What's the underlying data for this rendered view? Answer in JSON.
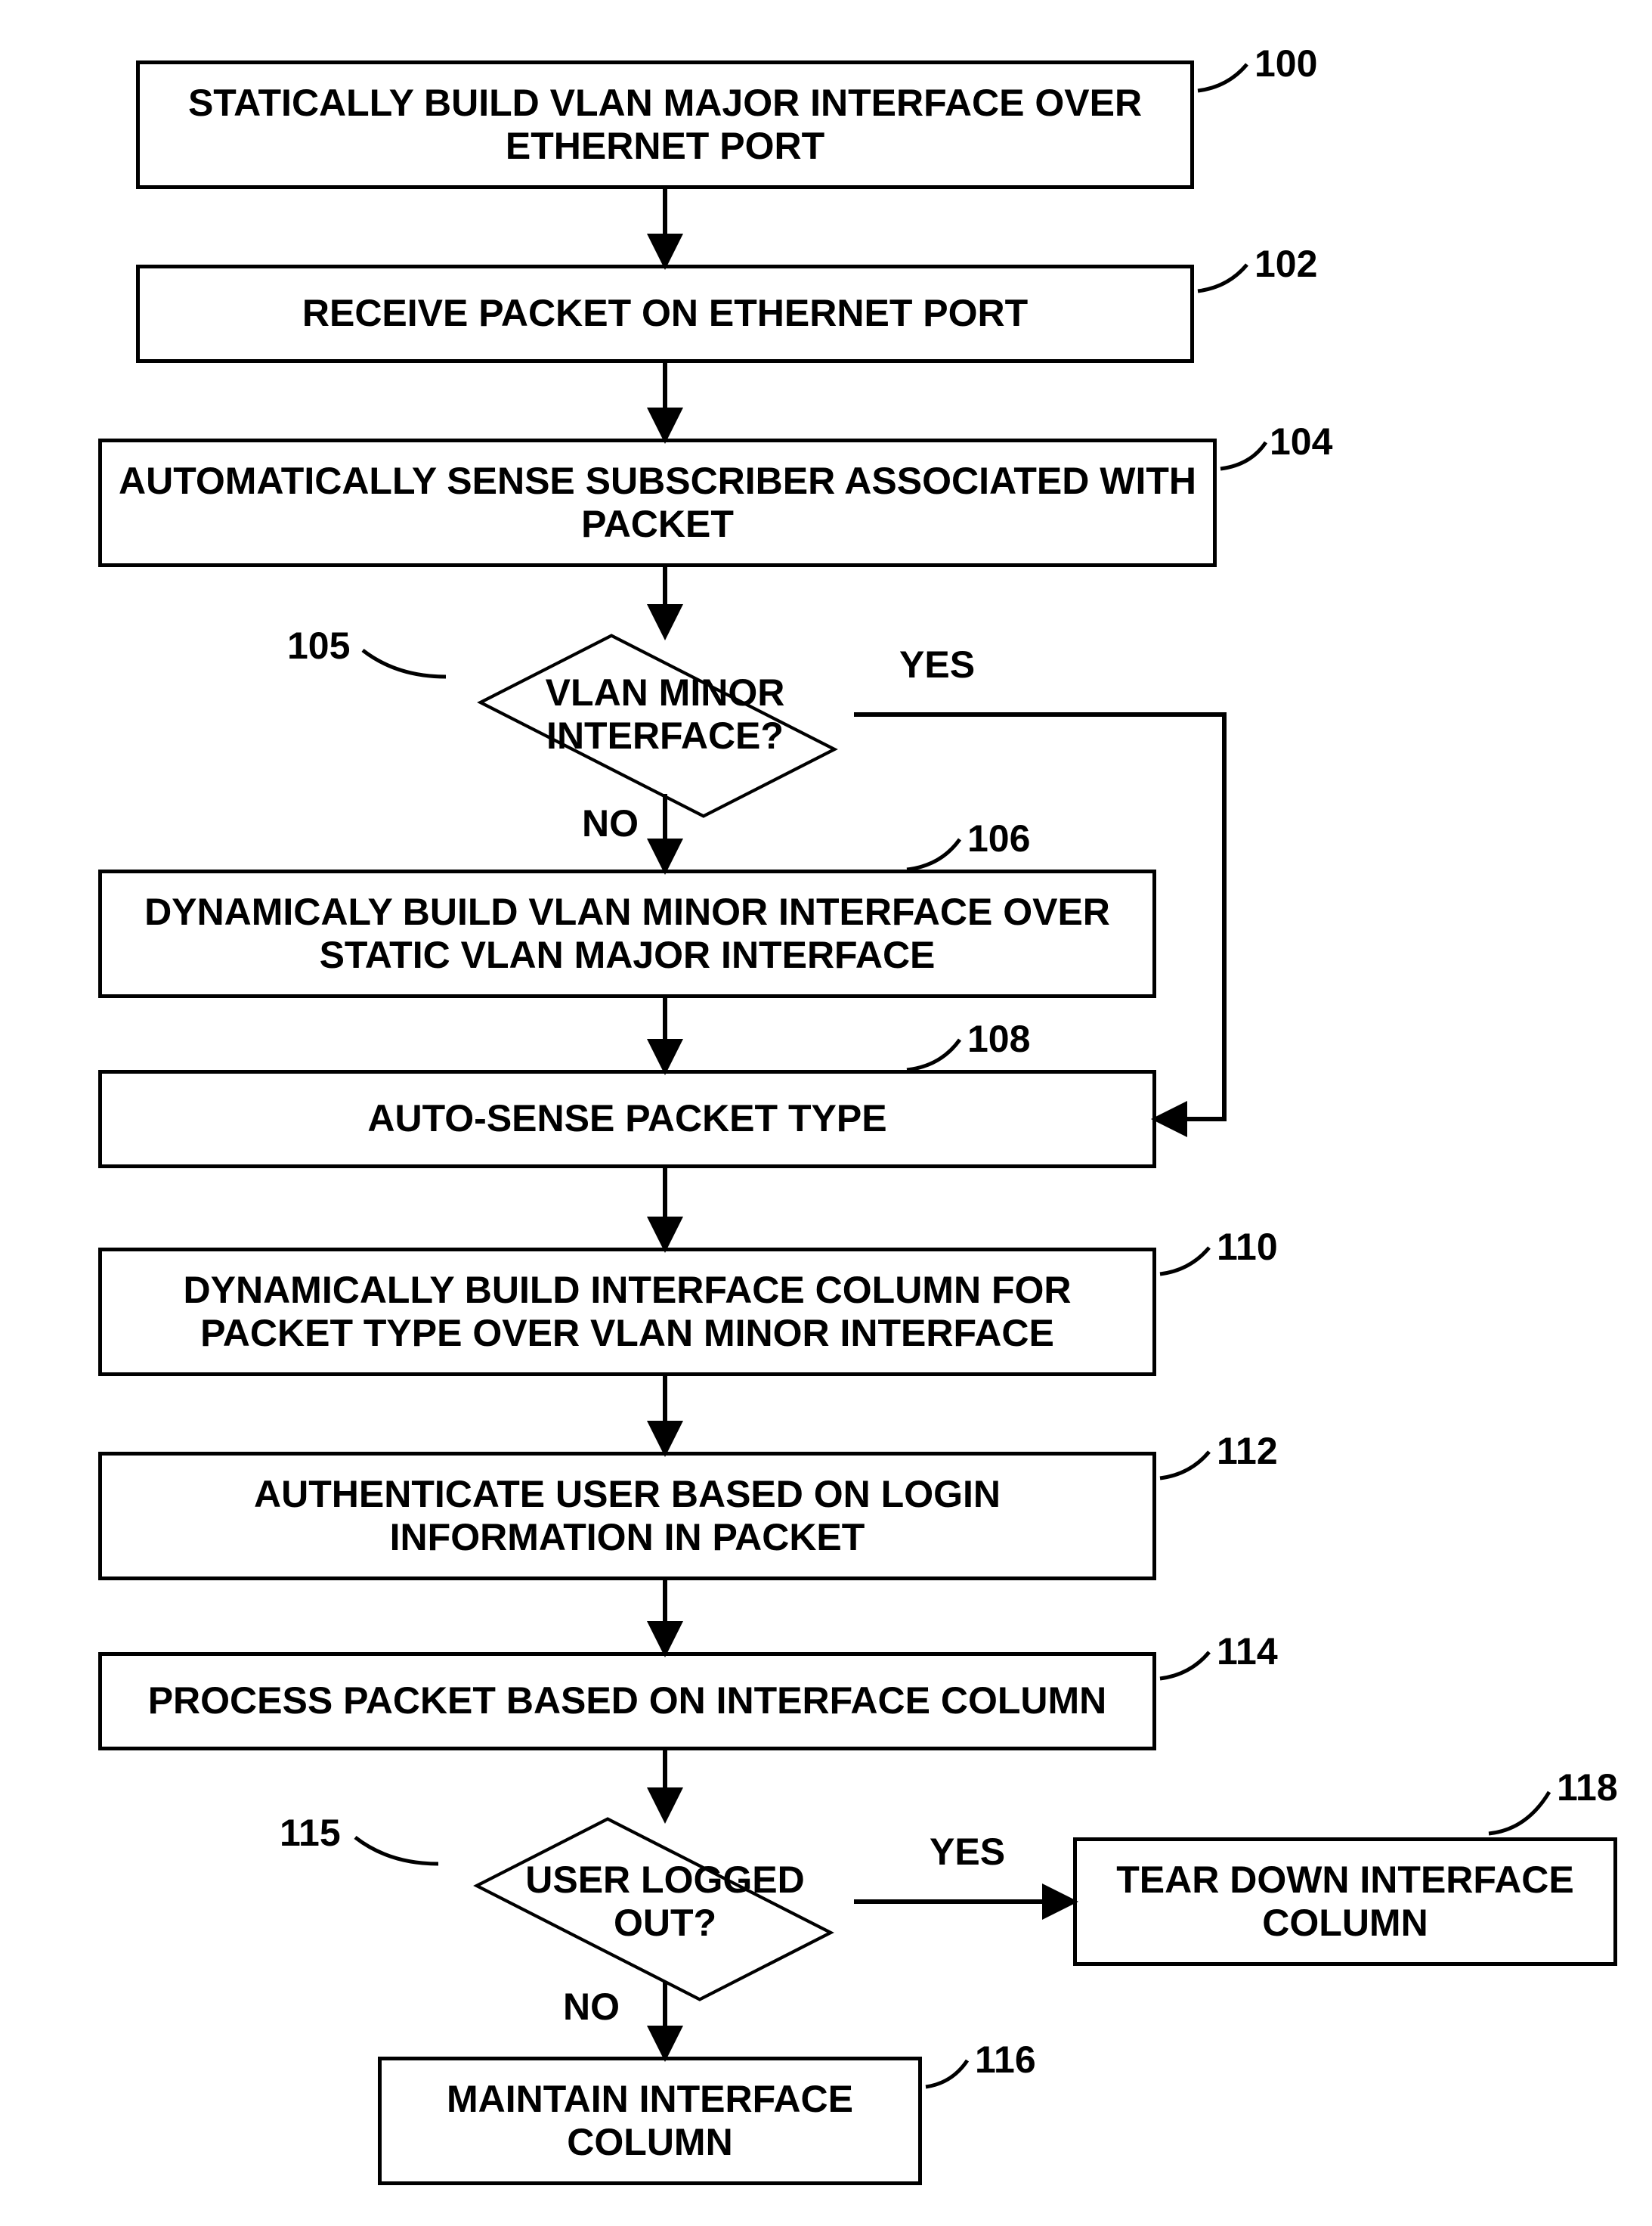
{
  "steps": {
    "s100": {
      "ref": "100",
      "text": "STATICALLY BUILD VLAN MAJOR INTERFACE OVER ETHERNET PORT"
    },
    "s102": {
      "ref": "102",
      "text": "RECEIVE PACKET ON ETHERNET PORT"
    },
    "s104": {
      "ref": "104",
      "text": "AUTOMATICALLY SENSE SUBSCRIBER ASSOCIATED WITH PACKET"
    },
    "s105": {
      "ref": "105",
      "text": "VLAN MINOR INTERFACE?"
    },
    "s106": {
      "ref": "106",
      "text": "DYNAMICALY BUILD VLAN MINOR INTERFACE OVER STATIC VLAN MAJOR INTERFACE"
    },
    "s108": {
      "ref": "108",
      "text": "AUTO-SENSE PACKET TYPE"
    },
    "s110": {
      "ref": "110",
      "text": "DYNAMICALLY BUILD INTERFACE COLUMN FOR PACKET TYPE OVER VLAN MINOR INTERFACE"
    },
    "s112": {
      "ref": "112",
      "text": "AUTHENTICATE USER BASED ON LOGIN INFORMATION IN PACKET"
    },
    "s114": {
      "ref": "114",
      "text": "PROCESS PACKET BASED ON INTERFACE COLUMN"
    },
    "s115": {
      "ref": "115",
      "text": "USER LOGGED OUT?"
    },
    "s116": {
      "ref": "116",
      "text": "MAINTAIN INTERFACE COLUMN"
    },
    "s118": {
      "ref": "118",
      "text": "TEAR DOWN INTERFACE COLUMN"
    }
  },
  "labels": {
    "yes": "YES",
    "no": "NO"
  },
  "chart_data": {
    "type": "flowchart",
    "nodes": [
      {
        "id": "100",
        "type": "process",
        "text": "STATICALLY BUILD VLAN MAJOR INTERFACE OVER ETHERNET PORT"
      },
      {
        "id": "102",
        "type": "process",
        "text": "RECEIVE PACKET ON ETHERNET PORT"
      },
      {
        "id": "104",
        "type": "process",
        "text": "AUTOMATICALLY SENSE SUBSCRIBER ASSOCIATED WITH PACKET"
      },
      {
        "id": "105",
        "type": "decision",
        "text": "VLAN MINOR INTERFACE?"
      },
      {
        "id": "106",
        "type": "process",
        "text": "DYNAMICALY BUILD VLAN MINOR INTERFACE OVER STATIC VLAN MAJOR INTERFACE"
      },
      {
        "id": "108",
        "type": "process",
        "text": "AUTO-SENSE PACKET TYPE"
      },
      {
        "id": "110",
        "type": "process",
        "text": "DYNAMICALLY BUILD INTERFACE COLUMN FOR PACKET TYPE OVER VLAN MINOR INTERFACE"
      },
      {
        "id": "112",
        "type": "process",
        "text": "AUTHENTICATE USER BASED ON LOGIN INFORMATION IN PACKET"
      },
      {
        "id": "114",
        "type": "process",
        "text": "PROCESS PACKET BASED ON INTERFACE COLUMN"
      },
      {
        "id": "115",
        "type": "decision",
        "text": "USER LOGGED OUT?"
      },
      {
        "id": "116",
        "type": "process",
        "text": "MAINTAIN INTERFACE COLUMN"
      },
      {
        "id": "118",
        "type": "process",
        "text": "TEAR DOWN INTERFACE COLUMN"
      }
    ],
    "edges": [
      {
        "from": "100",
        "to": "102"
      },
      {
        "from": "102",
        "to": "104"
      },
      {
        "from": "104",
        "to": "105"
      },
      {
        "from": "105",
        "to": "106",
        "label": "NO"
      },
      {
        "from": "105",
        "to": "108",
        "label": "YES"
      },
      {
        "from": "106",
        "to": "108"
      },
      {
        "from": "108",
        "to": "110"
      },
      {
        "from": "110",
        "to": "112"
      },
      {
        "from": "112",
        "to": "114"
      },
      {
        "from": "114",
        "to": "115"
      },
      {
        "from": "115",
        "to": "116",
        "label": "NO"
      },
      {
        "from": "115",
        "to": "118",
        "label": "YES"
      }
    ]
  }
}
